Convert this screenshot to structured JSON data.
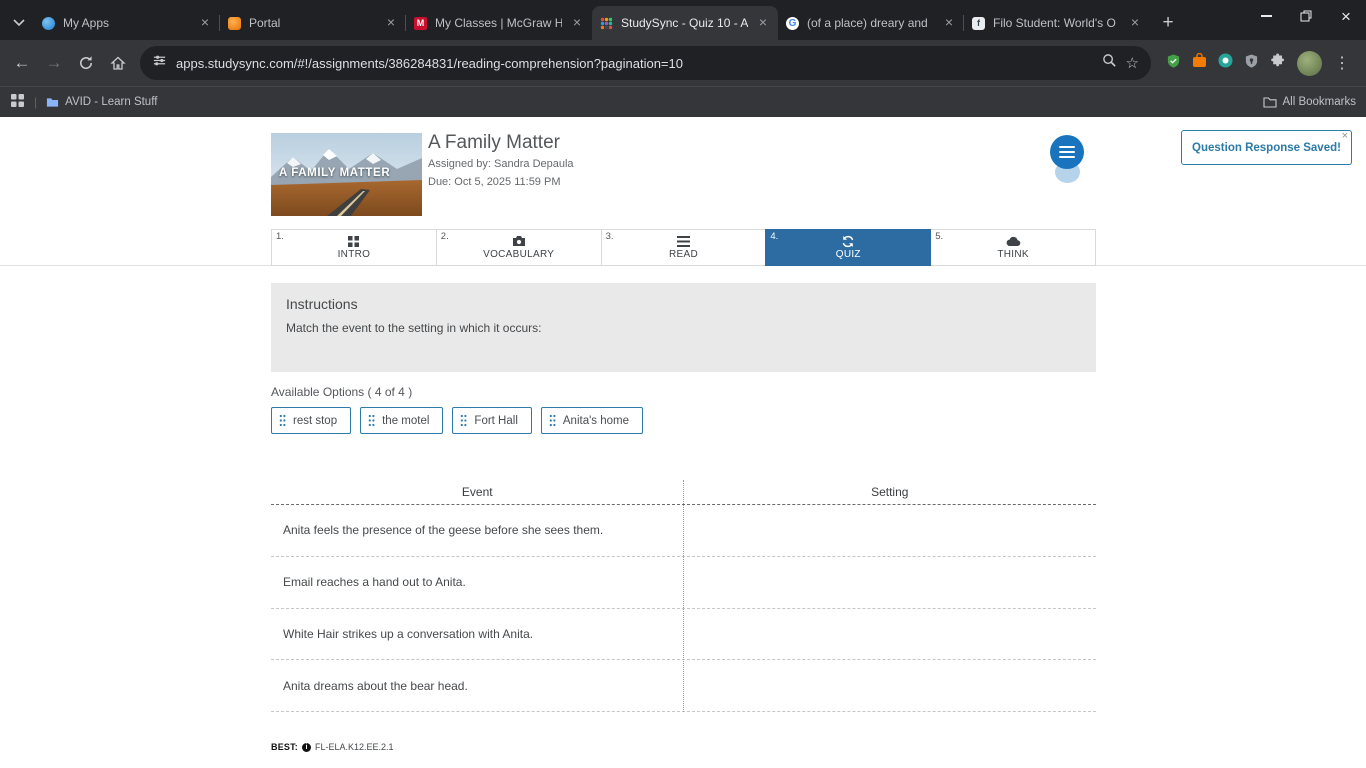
{
  "glyphs": {
    "close": "×",
    "plus": "+",
    "back": "←",
    "forward": "→",
    "kebab": "⋮",
    "star": "☆",
    "divider": "|",
    "m": "M",
    "g": "G",
    "f": "f",
    "info": "i"
  },
  "browser": {
    "tabs": [
      {
        "label": "My Apps"
      },
      {
        "label": "Portal"
      },
      {
        "label": "My Classes | McGraw Hill"
      },
      {
        "label": "StudySync - Quiz 10 - A"
      },
      {
        "label": "(of a place) dreary and"
      },
      {
        "label": "Filo Student: World's O"
      }
    ],
    "address": {
      "url": "apps.studysync.com/#!/assignments/386284831/reading-comprehension?pagination=10"
    },
    "bookmarks_bar": {
      "bookmark_label": "AVID - Learn Stuff",
      "all_bookmarks_label": "All Bookmarks"
    }
  },
  "page": {
    "header": {
      "title": "A Family Matter",
      "assigned_by": "Assigned by: Sandra Depaula",
      "due": "Due: Oct 5, 2025 11:59 PM",
      "thumbnail_text": "A FAMILY MATTER"
    },
    "notification": {
      "text": "Question Response Saved!"
    },
    "steps": [
      {
        "num": "1.",
        "label": "INTRO"
      },
      {
        "num": "2.",
        "label": "VOCABULARY"
      },
      {
        "num": "3.",
        "label": "READ"
      },
      {
        "num": "4.",
        "label": "QUIZ"
      },
      {
        "num": "5.",
        "label": "THINK"
      }
    ],
    "instructions": {
      "title": "Instructions",
      "text": "Match the event to the setting in which it occurs:"
    },
    "options_label": "Available Options ( 4 of 4 )",
    "options": [
      "rest stop",
      "the motel",
      "Fort Hall",
      "Anita's home"
    ],
    "table": {
      "headers": [
        "Event",
        "Setting"
      ],
      "rows": [
        "Anita feels the presence of the geese before she sees them.",
        "Email reaches a hand out to Anita.",
        "White Hair strikes up a conversation with Anita.",
        "Anita dreams about the bear head."
      ]
    },
    "footer": {
      "best_label": "BEST:",
      "standard": "FL-ELA.K12.EE.2.1"
    }
  },
  "colors": {
    "quiz_active_bg": "#2d6ca3",
    "option_border": "#2d7ba8",
    "notification": "#2b7ba6",
    "listen_button": "#1a74bd"
  }
}
